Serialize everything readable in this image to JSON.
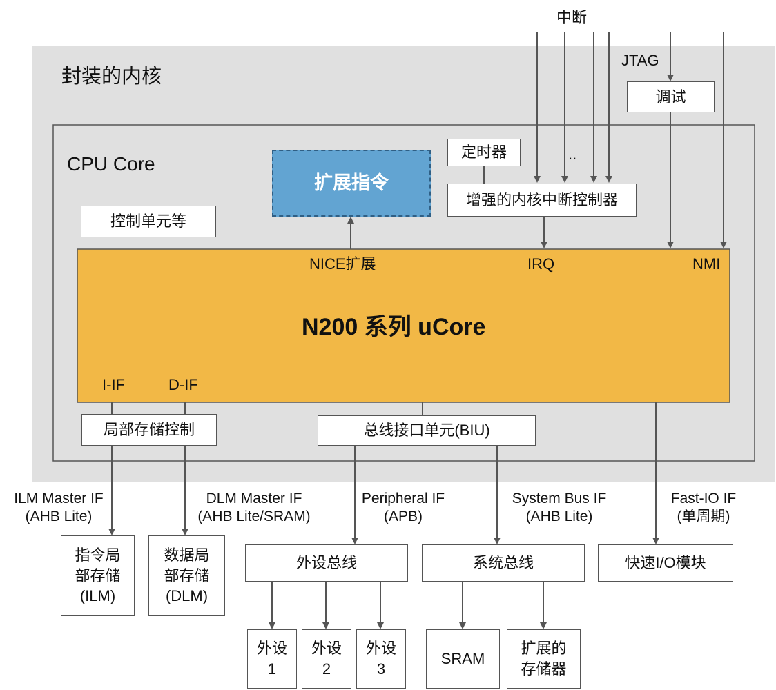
{
  "outer": {
    "title": "封装的内核"
  },
  "cpu": {
    "title": "CPU Core"
  },
  "ucore": {
    "title": "N200 系列 uCore"
  },
  "ports": {
    "nice": "NICE扩展",
    "irq": "IRQ",
    "nmi": "NMI",
    "iif": "I-IF",
    "dif": "D-IF"
  },
  "boxes": {
    "ext_instr": "扩展指令",
    "timer": "定时器",
    "eclic": "增强的内核中断控制器",
    "control": "控制单元等",
    "debug": "调试",
    "local_mem_ctrl": "局部存储控制",
    "biu": "总线接口单元(BIU)",
    "ilm": "指令局\n部存储\n(ILM)",
    "dlm": "数据局\n部存储\n(DLM)",
    "periph_bus": "外设总线",
    "sys_bus": "系统总线",
    "fastio": "快速I/O模块",
    "p1": "外设\n1",
    "p2": "外设\n2",
    "p3": "外设\n3",
    "sram": "SRAM",
    "ext_mem": "扩展的\n存储器"
  },
  "labels": {
    "interrupt": "中断",
    "jtag": "JTAG",
    "dots": "..",
    "ilm_if": "ILM Master IF\n(AHB Lite)",
    "dlm_if": "DLM Master IF\n(AHB Lite/SRAM)",
    "periph_if": "Peripheral IF\n(APB)",
    "sys_if": "System Bus IF\n(AHB Lite)",
    "fastio_if": "Fast-IO IF\n(单周期)"
  },
  "colors": {
    "outer_bg": "#e0e0e0",
    "ucore_fill": "#f2b846",
    "ext_instr_fill": "#62a4d2",
    "line": "#555555"
  }
}
